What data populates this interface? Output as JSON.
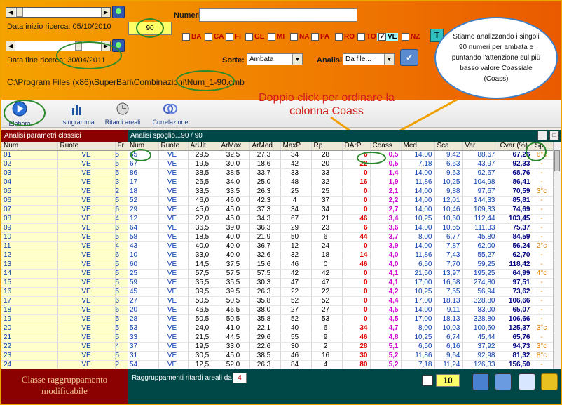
{
  "search": {
    "start_label": "Data inizio ricerca: 05/10/2010",
    "end_label": "Data fine ricerca: 30/04/2011",
    "count_value": "90",
    "numeri_label": "Numeri:",
    "numeri_value": "",
    "path": "C:\\Program Files (x86)\\SuperBari\\Combinazioni\\Num_1-90.cmb"
  },
  "wheels": [
    {
      "label": "BA",
      "checked": false
    },
    {
      "label": "CA",
      "checked": false
    },
    {
      "label": "FI",
      "checked": false
    },
    {
      "label": "GE",
      "checked": false
    },
    {
      "label": "MI",
      "checked": false
    },
    {
      "label": "NA",
      "checked": false
    },
    {
      "label": "PA",
      "checked": false
    },
    {
      "label": "RO",
      "checked": false
    },
    {
      "label": "TO",
      "checked": false
    },
    {
      "label": "VE",
      "checked": true
    },
    {
      "label": "NZ",
      "checked": false
    }
  ],
  "tbutton_label": "T",
  "sorte": {
    "label": "Sorte:",
    "value": "Ambata"
  },
  "analisi": {
    "label": "Analisi:",
    "value": "Da file..."
  },
  "bubble_text": "Stiamo analizzando i singoli 90 numeri per ambata e puntando l'attenzione sul più basso valore Coassiale (Coass)",
  "callout_text": "Doppio click per ordinare la colonna Coass",
  "toolbar": [
    {
      "label": "Elabora",
      "icon": "play-icon"
    },
    {
      "label": "Istogramma",
      "icon": "histogram-icon"
    },
    {
      "label": "Ritardi areali",
      "icon": "clock-icon"
    },
    {
      "label": "Correlazione",
      "icon": "rings-icon"
    }
  ],
  "left_panel": {
    "title": "Analisi parametri classici",
    "columns": [
      "Num",
      "Ruote",
      "Fr"
    ],
    "footer": "Classe raggruppamento modificabile"
  },
  "right_panel": {
    "title": "Analisi spoglio...90 / 90",
    "columns": [
      "Num",
      "Ruote",
      "ArUlt",
      "ArMax",
      "ArMed",
      "MaxP",
      "Rp",
      "DArP",
      "Coass",
      "Med",
      "Sca",
      "Var",
      "Cvar (%)",
      "Sp"
    ],
    "footer_label": "Raggruppamenti ritardi areali da",
    "footer_value": "4",
    "count_box": "10"
  },
  "rows": [
    {
      "l": [
        "01",
        "VE",
        "5"
      ],
      "r": [
        "55",
        "VE",
        "29,5",
        "32,5",
        "27,3",
        "34",
        "28",
        "6",
        "0,5",
        "14,00",
        "9,42",
        "88,67",
        "67,26",
        "6°c"
      ]
    },
    {
      "l": [
        "02",
        "VE",
        "5"
      ],
      "r": [
        "67",
        "VE",
        "19,5",
        "30,0",
        "18,6",
        "42",
        "20",
        "22",
        "0,5",
        "7,18",
        "6,63",
        "43,97",
        "92,33",
        "-"
      ]
    },
    {
      "l": [
        "03",
        "VE",
        "5"
      ],
      "r": [
        "86",
        "VE",
        "38,5",
        "38,5",
        "33,7",
        "33",
        "33",
        "0",
        "1,4",
        "14,00",
        "9,63",
        "92,67",
        "68,76",
        "-"
      ]
    },
    {
      "l": [
        "04",
        "VE",
        "3"
      ],
      "r": [
        "17",
        "VE",
        "26,5",
        "34,0",
        "25,0",
        "48",
        "32",
        "16",
        "1,9",
        "11,86",
        "10,25",
        "104,98",
        "86,41",
        "-"
      ]
    },
    {
      "l": [
        "05",
        "VE",
        "2"
      ],
      "r": [
        "18",
        "VE",
        "33,5",
        "33,5",
        "26,3",
        "25",
        "25",
        "0",
        "2,1",
        "14,00",
        "9,88",
        "97,67",
        "70,59",
        "3°c"
      ]
    },
    {
      "l": [
        "06",
        "VE",
        "5"
      ],
      "r": [
        "52",
        "VE",
        "46,0",
        "46,0",
        "42,3",
        "4",
        "37",
        "0",
        "2,2",
        "14,00",
        "12,01",
        "144,33",
        "85,81",
        "-"
      ]
    },
    {
      "l": [
        "07",
        "VE",
        "6"
      ],
      "r": [
        "29",
        "VE",
        "45,0",
        "45,0",
        "37,3",
        "34",
        "34",
        "0",
        "2,7",
        "14,00",
        "10,46",
        "109,33",
        "74,69",
        "-"
      ]
    },
    {
      "l": [
        "08",
        "VE",
        "4"
      ],
      "r": [
        "12",
        "VE",
        "22,0",
        "45,0",
        "34,3",
        "67",
        "21",
        "46",
        "3,4",
        "10,25",
        "10,60",
        "112,44",
        "103,45",
        "-"
      ]
    },
    {
      "l": [
        "09",
        "VE",
        "6"
      ],
      "r": [
        "64",
        "VE",
        "36,5",
        "39,0",
        "36,3",
        "29",
        "23",
        "6",
        "3,6",
        "14,00",
        "10,55",
        "111,33",
        "75,37",
        "-"
      ]
    },
    {
      "l": [
        "10",
        "VE",
        "5"
      ],
      "r": [
        "58",
        "VE",
        "18,5",
        "40,0",
        "21,9",
        "50",
        "6",
        "44",
        "3,7",
        "8,00",
        "6,77",
        "45,80",
        "84,59",
        "-"
      ]
    },
    {
      "l": [
        "11",
        "VE",
        "4"
      ],
      "r": [
        "43",
        "VE",
        "40,0",
        "40,0",
        "36,7",
        "12",
        "24",
        "0",
        "3,9",
        "14,00",
        "7,87",
        "62,00",
        "56,24",
        "2°c"
      ]
    },
    {
      "l": [
        "12",
        "VE",
        "6"
      ],
      "r": [
        "10",
        "VE",
        "33,0",
        "40,0",
        "32,6",
        "32",
        "18",
        "14",
        "4,0",
        "11,86",
        "7,43",
        "55,27",
        "62,70",
        "-"
      ]
    },
    {
      "l": [
        "13",
        "VE",
        "5"
      ],
      "r": [
        "60",
        "VE",
        "14,5",
        "37,5",
        "15,6",
        "46",
        "0",
        "46",
        "4,0",
        "6,50",
        "7,70",
        "59,25",
        "118,42",
        "-"
      ]
    },
    {
      "l": [
        "14",
        "VE",
        "5"
      ],
      "r": [
        "25",
        "VE",
        "57,5",
        "57,5",
        "57,5",
        "42",
        "42",
        "0",
        "4,1",
        "21,50",
        "13,97",
        "195,25",
        "64,99",
        "4°c"
      ]
    },
    {
      "l": [
        "15",
        "VE",
        "5"
      ],
      "r": [
        "59",
        "VE",
        "35,5",
        "35,5",
        "30,3",
        "47",
        "47",
        "0",
        "4,1",
        "17,00",
        "16,58",
        "274,80",
        "97,51",
        "-"
      ]
    },
    {
      "l": [
        "16",
        "VE",
        "5"
      ],
      "r": [
        "45",
        "VE",
        "39,5",
        "39,5",
        "26,3",
        "22",
        "22",
        "0",
        "4,2",
        "10,25",
        "7,55",
        "56,94",
        "73,62",
        "-"
      ]
    },
    {
      "l": [
        "17",
        "VE",
        "6"
      ],
      "r": [
        "27",
        "VE",
        "50,5",
        "50,5",
        "35,8",
        "52",
        "52",
        "0",
        "4,4",
        "17,00",
        "18,13",
        "328,80",
        "106,66",
        "-"
      ]
    },
    {
      "l": [
        "18",
        "VE",
        "6"
      ],
      "r": [
        "20",
        "VE",
        "46,5",
        "46,5",
        "38,0",
        "27",
        "27",
        "0",
        "4,5",
        "14,00",
        "9,11",
        "83,00",
        "65,07",
        "-"
      ]
    },
    {
      "l": [
        "19",
        "VE",
        "5"
      ],
      "r": [
        "28",
        "VE",
        "50,5",
        "50,5",
        "35,8",
        "52",
        "53",
        "0",
        "4,5",
        "17,00",
        "18,13",
        "328,80",
        "106,66",
        "-"
      ]
    },
    {
      "l": [
        "20",
        "VE",
        "5"
      ],
      "r": [
        "53",
        "VE",
        "24,0",
        "41,0",
        "22,1",
        "40",
        "6",
        "34",
        "4,7",
        "8,00",
        "10,03",
        "100,60",
        "125,37",
        "3°c"
      ]
    },
    {
      "l": [
        "21",
        "VE",
        "5"
      ],
      "r": [
        "33",
        "VE",
        "21,5",
        "44,5",
        "29,6",
        "55",
        "9",
        "46",
        "4,8",
        "10,25",
        "6,74",
        "45,44",
        "65,76",
        "-"
      ]
    },
    {
      "l": [
        "22",
        "VE",
        "4"
      ],
      "r": [
        "37",
        "VE",
        "19,5",
        "33,0",
        "22,6",
        "30",
        "2",
        "28",
        "5,1",
        "6,50",
        "6,16",
        "37,92",
        "94,73",
        "3°c"
      ]
    },
    {
      "l": [
        "23",
        "VE",
        "5"
      ],
      "r": [
        "31",
        "VE",
        "30,5",
        "45,0",
        "38,5",
        "46",
        "16",
        "30",
        "5,2",
        "11,86",
        "9,64",
        "92,98",
        "81,32",
        "8°c"
      ]
    },
    {
      "l": [
        "24",
        "VE",
        "2"
      ],
      "r": [
        "54",
        "VE",
        "12,5",
        "52,0",
        "26,3",
        "84",
        "4",
        "80",
        "5,2",
        "7,18",
        "11,24",
        "126,33",
        "156,50",
        "-"
      ]
    }
  ]
}
